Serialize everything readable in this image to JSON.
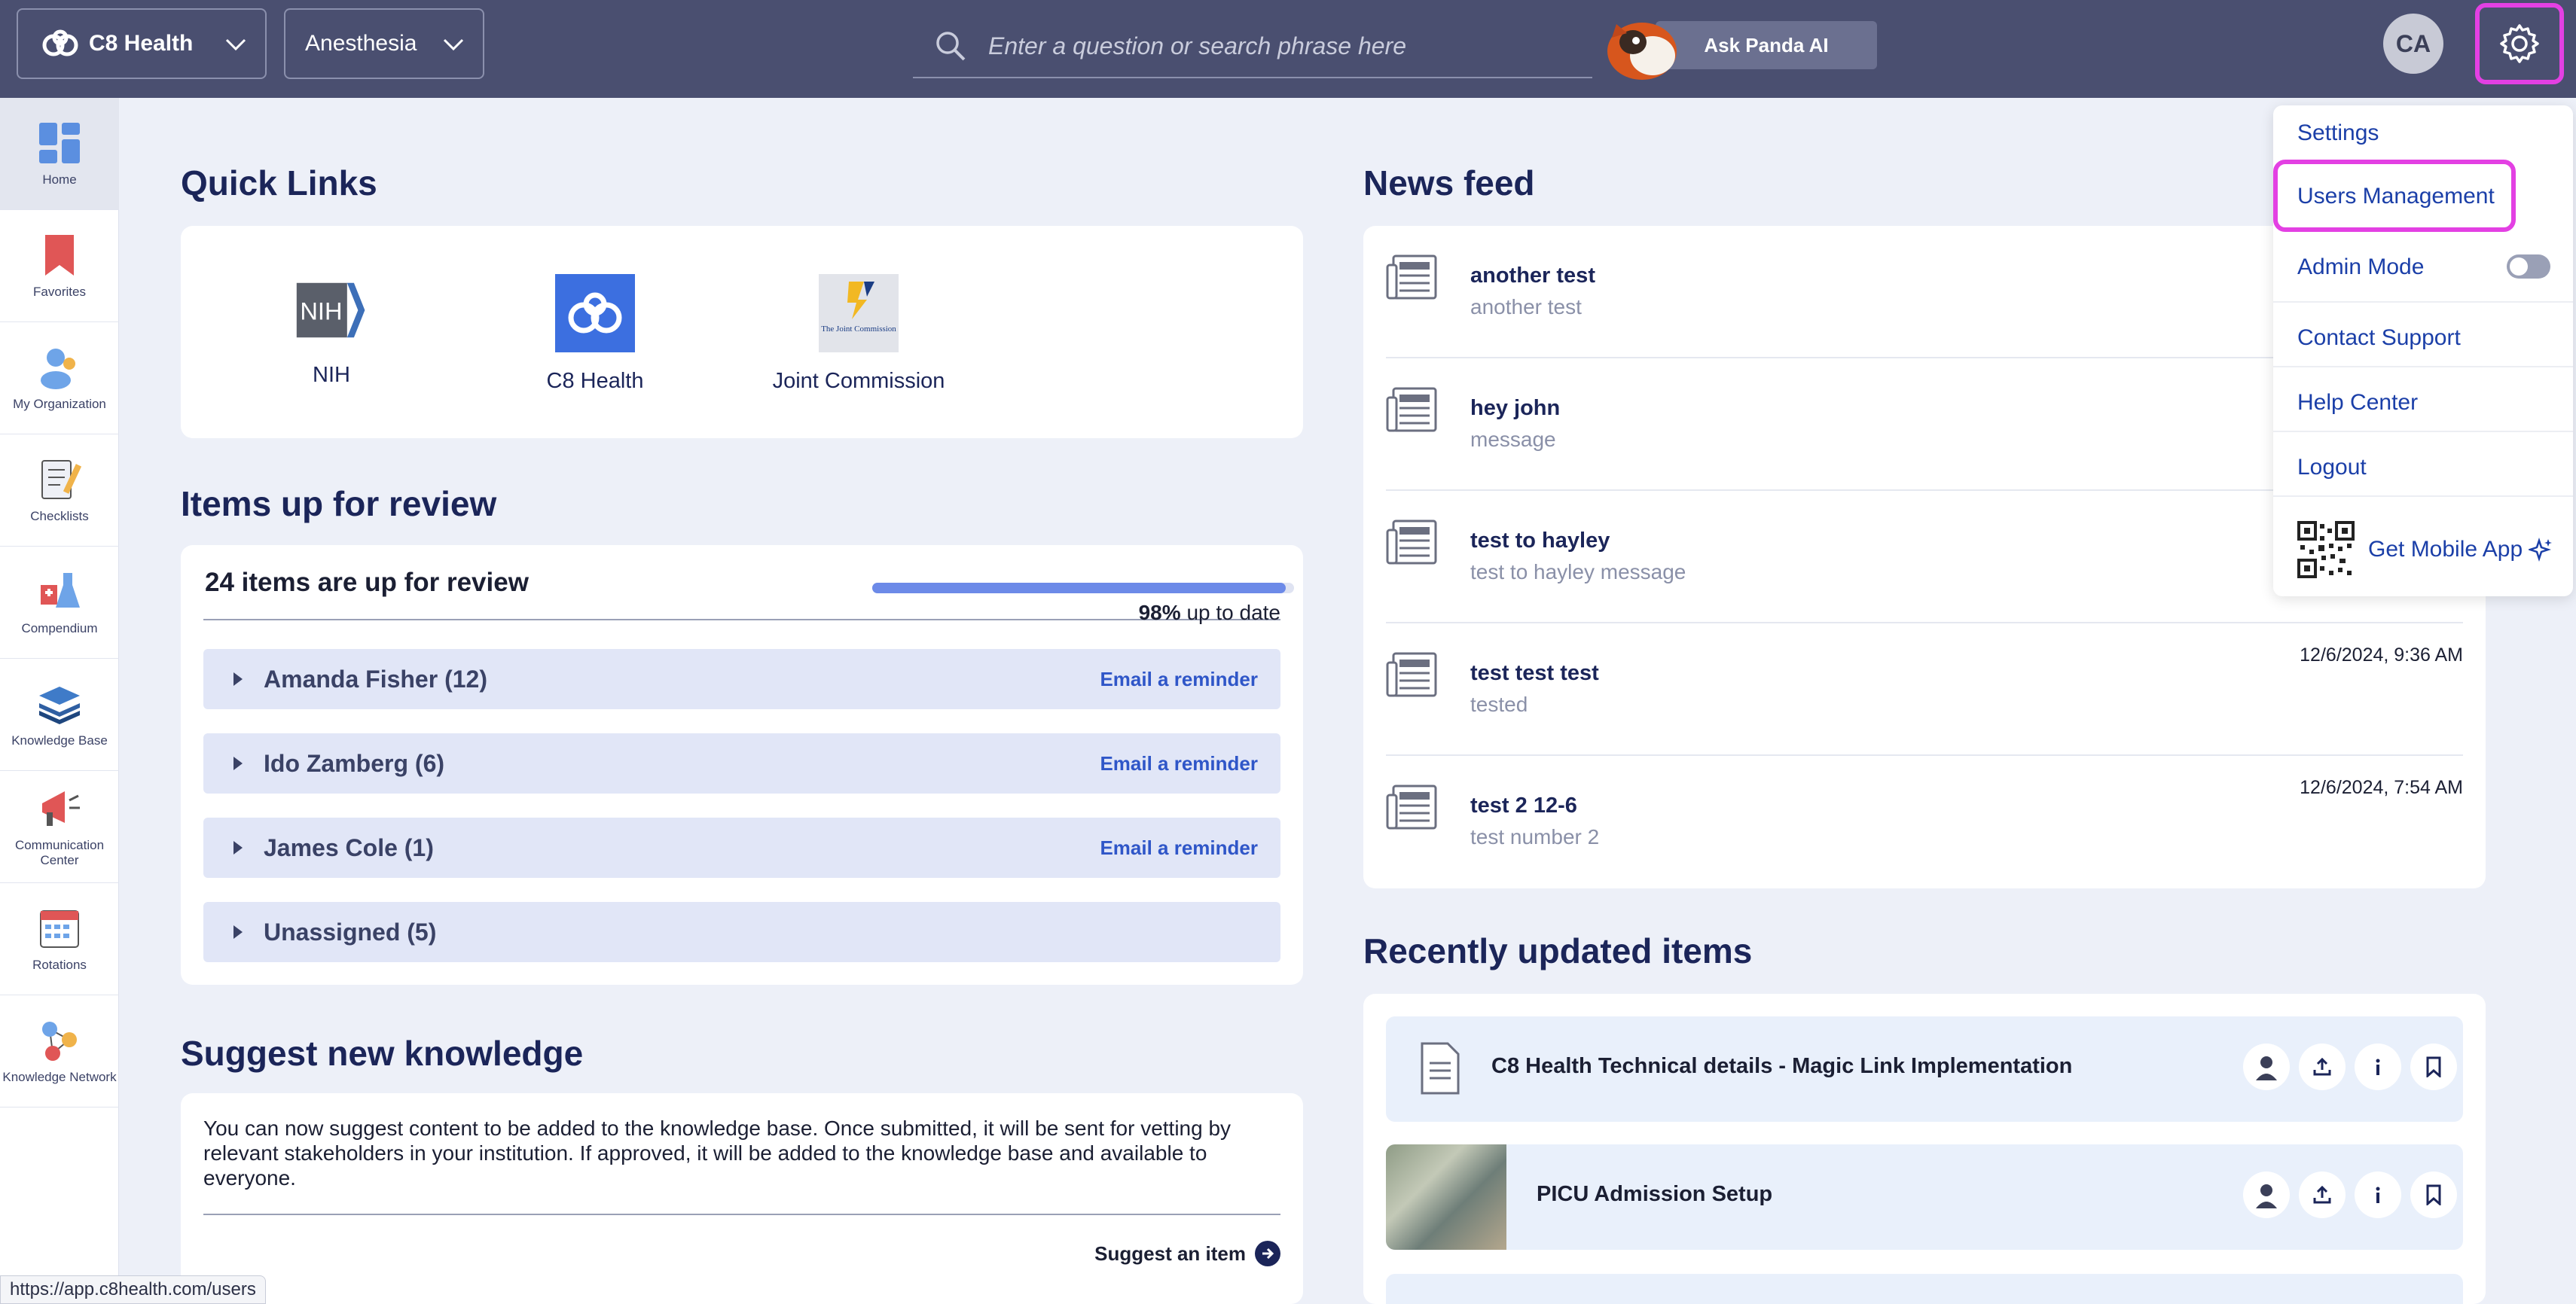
{
  "header": {
    "brand_label": "C8 Health",
    "department_label": "Anesthesia",
    "search_placeholder": "Enter a question or search phrase here",
    "ask_ai_label": "Ask Panda AI",
    "avatar_initials": "CA"
  },
  "sidebar": {
    "items": [
      {
        "label": "Home",
        "icon": "home-icon",
        "active": true
      },
      {
        "label": "Favorites",
        "icon": "bookmark-icon"
      },
      {
        "label": "My Organization",
        "icon": "organization-icon"
      },
      {
        "label": "Checklists",
        "icon": "checklist-icon"
      },
      {
        "label": "Compendium",
        "icon": "flask-icon"
      },
      {
        "label": "Knowledge Base",
        "icon": "books-icon"
      },
      {
        "label": "Communication Center",
        "icon": "megaphone-icon"
      },
      {
        "label": "Rotations",
        "icon": "calendar-icon"
      },
      {
        "label": "Knowledge Network",
        "icon": "network-icon"
      }
    ]
  },
  "quick_links": {
    "title": "Quick Links",
    "items": [
      {
        "label": "NIH",
        "logo_text": "NIH"
      },
      {
        "label": "C8 Health"
      },
      {
        "label": "Joint Commission",
        "logo_text": "The Joint Commission"
      }
    ]
  },
  "review": {
    "title": "Items up for review",
    "count_text": "24 items are up for review",
    "percent_text": "98%",
    "uptodate_suffix": "up to date",
    "progress_fraction": 0.98,
    "rows": [
      {
        "label": "Amanda Fisher (12)",
        "action": "Email a reminder"
      },
      {
        "label": "Ido Zamberg (6)",
        "action": "Email a reminder"
      },
      {
        "label": "James Cole (1)",
        "action": "Email a reminder"
      },
      {
        "label": "Unassigned (5)",
        "action": ""
      }
    ]
  },
  "suggest": {
    "title": "Suggest new knowledge",
    "text": "You can now suggest content to be added to the knowledge base. Once submitted, it will be sent for vetting by relevant stakeholders in your institution. If approved, it will be added to the knowledge base and available to everyone.",
    "link_label": "Suggest an item"
  },
  "news": {
    "title": "News feed",
    "items": [
      {
        "title": "another test",
        "subtitle": "another test",
        "date": ""
      },
      {
        "title": "hey john",
        "subtitle": "message",
        "date": ""
      },
      {
        "title": "test to hayley",
        "subtitle": "test to hayley message",
        "date": ""
      },
      {
        "title": "test test test",
        "subtitle": "tested",
        "date": "12/6/2024, 9:36 AM"
      },
      {
        "title": "test 2 12-6",
        "subtitle": "test number 2",
        "date": "12/6/2024, 7:54 AM"
      }
    ]
  },
  "recent": {
    "title": "Recently updated items",
    "items": [
      {
        "title": "C8 Health Technical details - Magic Link Implementation"
      },
      {
        "title": "PICU Admission Setup"
      }
    ]
  },
  "menu": {
    "items": [
      {
        "label": "Settings"
      },
      {
        "label": "Users Management"
      },
      {
        "label": "Admin Mode"
      },
      {
        "label": "Contact Support"
      },
      {
        "label": "Help Center"
      },
      {
        "label": "Logout"
      },
      {
        "label": "Get Mobile App"
      }
    ],
    "admin_mode_on": false
  },
  "status_bar": {
    "url": "https://app.c8health.com/users"
  },
  "colors": {
    "topbar": "#4a4f70",
    "accent_highlight": "#e340e3",
    "link_blue": "#2f56c8",
    "navy": "#1b2559"
  }
}
